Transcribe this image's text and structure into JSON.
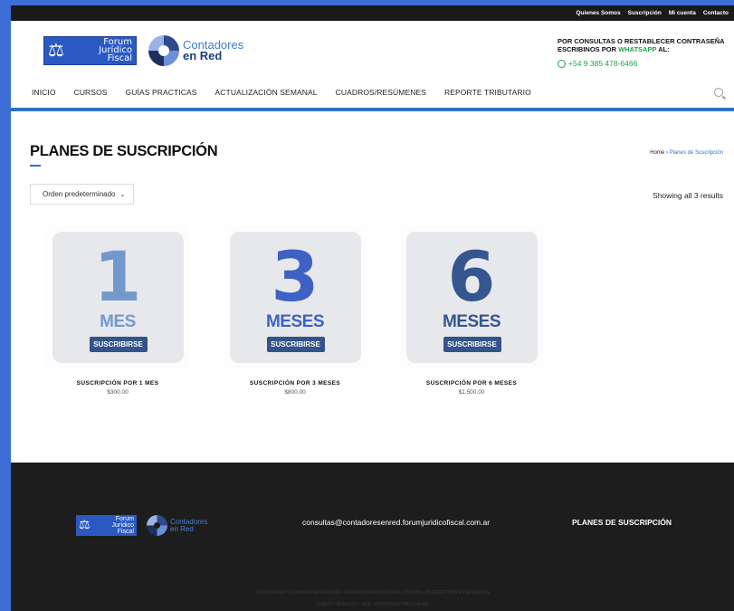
{
  "topbar": {
    "links": [
      "Quienes Somos",
      "Suscripción",
      "Mi cuenta",
      "Contacto"
    ]
  },
  "header": {
    "logo_forum_lines": [
      "Forum",
      "Jurídico",
      "Fiscal"
    ],
    "logo_cr_line1": "Contadores",
    "logo_cr_line2": "en Red",
    "contact_line1": "POR CONSULTAS O RESTABLECER CONTRASEÑA",
    "contact_line2_pre": "ESCRIBINOS POR ",
    "contact_line2_wa": "WHATSAPP",
    "contact_line2_post": " AL:",
    "phone": "+54 9 385 478-6466"
  },
  "nav": {
    "items": [
      "INICIO",
      "CURSOS",
      "GUÍAS PRACTICAS",
      "ACTUALIZACIÓN SEMANAL",
      "CUADROS/RESÚMENES",
      "REPORTE TRIBUTARIO"
    ]
  },
  "main": {
    "title": "PLANES DE SUSCRIPCIÓN",
    "breadcrumb_home": "Home",
    "breadcrumb_sep": " › ",
    "breadcrumb_current": "Planes de Suscripción",
    "sort_label": "Orden predeterminado",
    "results": "Showing all 3 results",
    "products": [
      {
        "number": "1",
        "unit": "MES",
        "button": "SUSCRIBIRSE",
        "name": "SUSCRIPCIÓN POR 1 MES",
        "price": "$300.00"
      },
      {
        "number": "3",
        "unit": "MESES",
        "button": "SUSCRIBIRSE",
        "name": "SUSCRIPCIÓN POR 3 MESES",
        "price": "$800.00"
      },
      {
        "number": "6",
        "unit": "MESES",
        "button": "SUSCRIBIRSE",
        "name": "SUSCRIPCIÓN POR 6 MESES",
        "price": "$1.500.00"
      }
    ]
  },
  "footer": {
    "logo_forum_lines": [
      "Forum",
      "Jurídico",
      "Fiscal"
    ],
    "logo_cr_line1": "Contadores",
    "logo_cr_line2": "en Red",
    "email": "consultas@contadoresenred.forumjuridicofiscal.com.ar",
    "plans_title": "PLANES DE SUSCRIPCIÓN",
    "copyright": "© COPYRIGHT | CONTADORES EN RED - FORUM JURIDICO FISCAL | TODOS LOS DERECHOS RESERVADOS",
    "design": "DISEÑO GRÁFICO Y WEB: WWW.BOCETAR.COM.AR"
  },
  "colors": {
    "accent": "#2f74c0",
    "whatsapp": "#1aa64a",
    "footer_bg": "#1d1d1d"
  }
}
